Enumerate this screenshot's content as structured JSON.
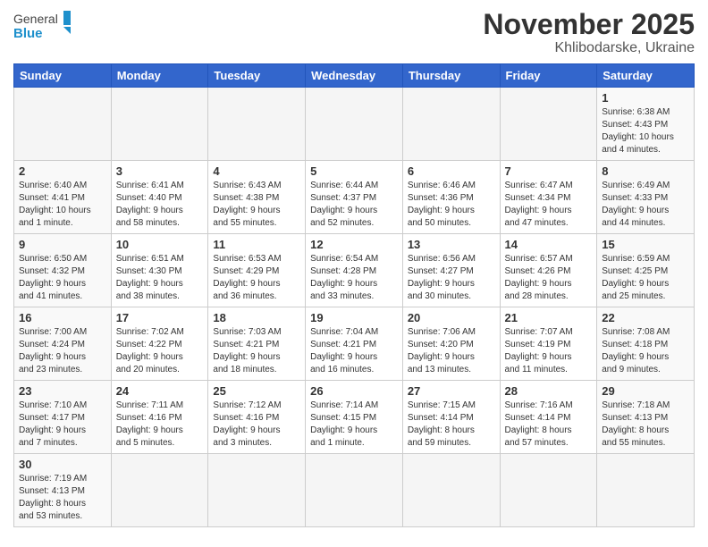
{
  "header": {
    "logo_text_general": "General",
    "logo_text_blue": "Blue",
    "month_title": "November 2025",
    "location": "Khlibodarske, Ukraine"
  },
  "weekdays": [
    "Sunday",
    "Monday",
    "Tuesday",
    "Wednesday",
    "Thursday",
    "Friday",
    "Saturday"
  ],
  "weeks": [
    [
      {
        "day": "",
        "info": "",
        "empty": true
      },
      {
        "day": "",
        "info": "",
        "empty": true
      },
      {
        "day": "",
        "info": "",
        "empty": true
      },
      {
        "day": "",
        "info": "",
        "empty": true
      },
      {
        "day": "",
        "info": "",
        "empty": true
      },
      {
        "day": "",
        "info": "",
        "empty": true
      },
      {
        "day": "1",
        "info": "Sunrise: 6:38 AM\nSunset: 4:43 PM\nDaylight: 10 hours\nand 4 minutes."
      }
    ],
    [
      {
        "day": "2",
        "info": "Sunrise: 6:40 AM\nSunset: 4:41 PM\nDaylight: 10 hours\nand 1 minute."
      },
      {
        "day": "3",
        "info": "Sunrise: 6:41 AM\nSunset: 4:40 PM\nDaylight: 9 hours\nand 58 minutes."
      },
      {
        "day": "4",
        "info": "Sunrise: 6:43 AM\nSunset: 4:38 PM\nDaylight: 9 hours\nand 55 minutes."
      },
      {
        "day": "5",
        "info": "Sunrise: 6:44 AM\nSunset: 4:37 PM\nDaylight: 9 hours\nand 52 minutes."
      },
      {
        "day": "6",
        "info": "Sunrise: 6:46 AM\nSunset: 4:36 PM\nDaylight: 9 hours\nand 50 minutes."
      },
      {
        "day": "7",
        "info": "Sunrise: 6:47 AM\nSunset: 4:34 PM\nDaylight: 9 hours\nand 47 minutes."
      },
      {
        "day": "8",
        "info": "Sunrise: 6:49 AM\nSunset: 4:33 PM\nDaylight: 9 hours\nand 44 minutes."
      }
    ],
    [
      {
        "day": "9",
        "info": "Sunrise: 6:50 AM\nSunset: 4:32 PM\nDaylight: 9 hours\nand 41 minutes."
      },
      {
        "day": "10",
        "info": "Sunrise: 6:51 AM\nSunset: 4:30 PM\nDaylight: 9 hours\nand 38 minutes."
      },
      {
        "day": "11",
        "info": "Sunrise: 6:53 AM\nSunset: 4:29 PM\nDaylight: 9 hours\nand 36 minutes."
      },
      {
        "day": "12",
        "info": "Sunrise: 6:54 AM\nSunset: 4:28 PM\nDaylight: 9 hours\nand 33 minutes."
      },
      {
        "day": "13",
        "info": "Sunrise: 6:56 AM\nSunset: 4:27 PM\nDaylight: 9 hours\nand 30 minutes."
      },
      {
        "day": "14",
        "info": "Sunrise: 6:57 AM\nSunset: 4:26 PM\nDaylight: 9 hours\nand 28 minutes."
      },
      {
        "day": "15",
        "info": "Sunrise: 6:59 AM\nSunset: 4:25 PM\nDaylight: 9 hours\nand 25 minutes."
      }
    ],
    [
      {
        "day": "16",
        "info": "Sunrise: 7:00 AM\nSunset: 4:24 PM\nDaylight: 9 hours\nand 23 minutes."
      },
      {
        "day": "17",
        "info": "Sunrise: 7:02 AM\nSunset: 4:22 PM\nDaylight: 9 hours\nand 20 minutes."
      },
      {
        "day": "18",
        "info": "Sunrise: 7:03 AM\nSunset: 4:21 PM\nDaylight: 9 hours\nand 18 minutes."
      },
      {
        "day": "19",
        "info": "Sunrise: 7:04 AM\nSunset: 4:21 PM\nDaylight: 9 hours\nand 16 minutes."
      },
      {
        "day": "20",
        "info": "Sunrise: 7:06 AM\nSunset: 4:20 PM\nDaylight: 9 hours\nand 13 minutes."
      },
      {
        "day": "21",
        "info": "Sunrise: 7:07 AM\nSunset: 4:19 PM\nDaylight: 9 hours\nand 11 minutes."
      },
      {
        "day": "22",
        "info": "Sunrise: 7:08 AM\nSunset: 4:18 PM\nDaylight: 9 hours\nand 9 minutes."
      }
    ],
    [
      {
        "day": "23",
        "info": "Sunrise: 7:10 AM\nSunset: 4:17 PM\nDaylight: 9 hours\nand 7 minutes."
      },
      {
        "day": "24",
        "info": "Sunrise: 7:11 AM\nSunset: 4:16 PM\nDaylight: 9 hours\nand 5 minutes."
      },
      {
        "day": "25",
        "info": "Sunrise: 7:12 AM\nSunset: 4:16 PM\nDaylight: 9 hours\nand 3 minutes."
      },
      {
        "day": "26",
        "info": "Sunrise: 7:14 AM\nSunset: 4:15 PM\nDaylight: 9 hours\nand 1 minute."
      },
      {
        "day": "27",
        "info": "Sunrise: 7:15 AM\nSunset: 4:14 PM\nDaylight: 8 hours\nand 59 minutes."
      },
      {
        "day": "28",
        "info": "Sunrise: 7:16 AM\nSunset: 4:14 PM\nDaylight: 8 hours\nand 57 minutes."
      },
      {
        "day": "29",
        "info": "Sunrise: 7:18 AM\nSunset: 4:13 PM\nDaylight: 8 hours\nand 55 minutes."
      }
    ],
    [
      {
        "day": "30",
        "info": "Sunrise: 7:19 AM\nSunset: 4:13 PM\nDaylight: 8 hours\nand 53 minutes."
      },
      {
        "day": "",
        "info": "",
        "empty": true
      },
      {
        "day": "",
        "info": "",
        "empty": true
      },
      {
        "day": "",
        "info": "",
        "empty": true
      },
      {
        "day": "",
        "info": "",
        "empty": true
      },
      {
        "day": "",
        "info": "",
        "empty": true
      },
      {
        "day": "",
        "info": "",
        "empty": true
      }
    ]
  ]
}
